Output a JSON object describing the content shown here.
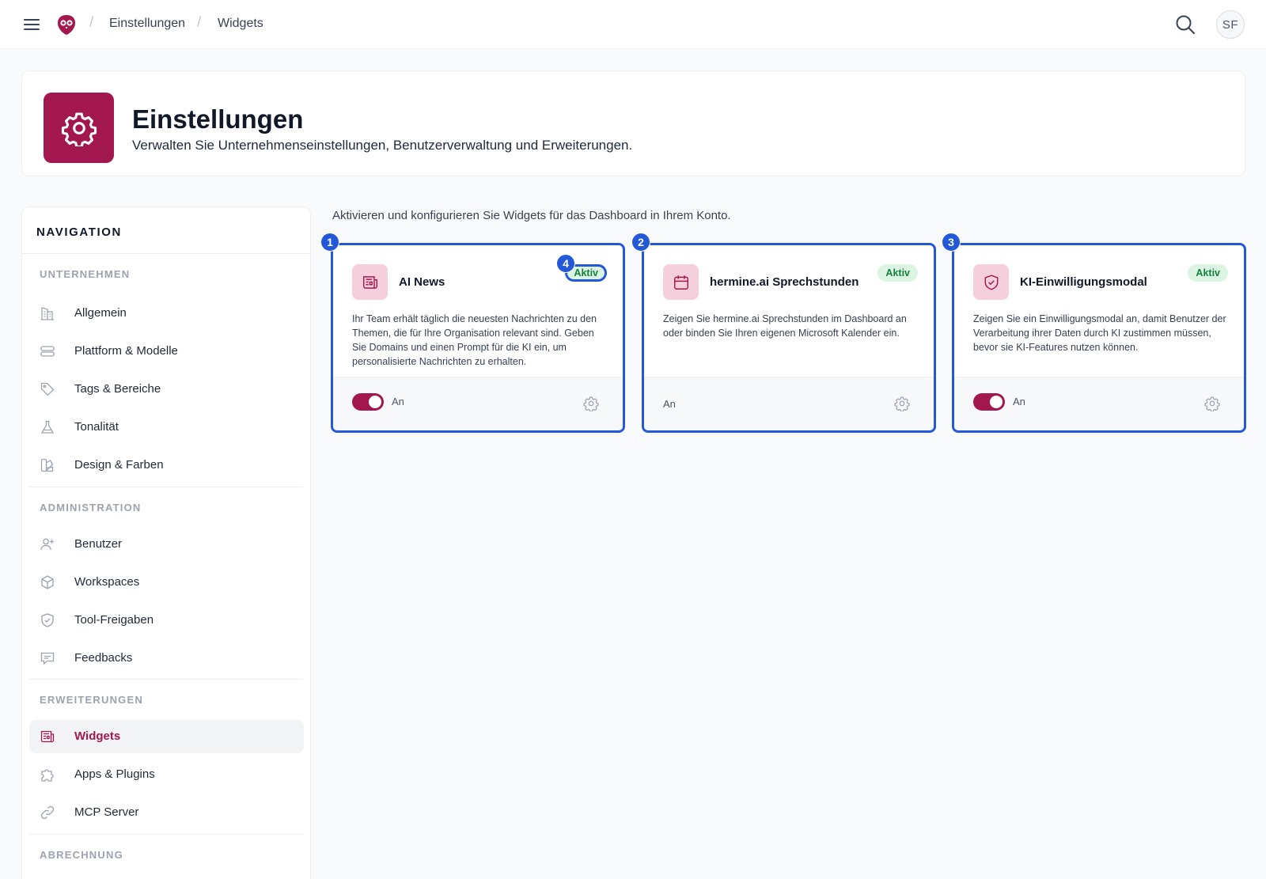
{
  "topbar": {
    "breadcrumbs": [
      "Einstellungen",
      "Widgets"
    ],
    "avatar_initials": "SF"
  },
  "header": {
    "title": "Einstellungen",
    "subtitle": "Verwalten Sie Unternehmenseinstellungen, Benutzerverwaltung und Erweiterungen."
  },
  "sidebar": {
    "title": "NAVIGATION",
    "sections": [
      {
        "label": "UNTERNEHMEN",
        "items": [
          {
            "label": "Allgemein",
            "icon": "building-icon"
          },
          {
            "label": "Plattform & Modelle",
            "icon": "server-icon"
          },
          {
            "label": "Tags & Bereiche",
            "icon": "tag-icon"
          },
          {
            "label": "Tonalität",
            "icon": "flask-icon"
          },
          {
            "label": "Design & Farben",
            "icon": "palette-icon"
          }
        ]
      },
      {
        "label": "ADMINISTRATION",
        "items": [
          {
            "label": "Benutzer",
            "icon": "user-plus-icon"
          },
          {
            "label": "Workspaces",
            "icon": "cube-icon"
          },
          {
            "label": "Tool-Freigaben",
            "icon": "shield-check-icon"
          },
          {
            "label": "Feedbacks",
            "icon": "chat-icon"
          }
        ]
      },
      {
        "label": "ERWEITERUNGEN",
        "items": [
          {
            "label": "Widgets",
            "icon": "newspaper-icon",
            "active": true
          },
          {
            "label": "Apps & Plugins",
            "icon": "puzzle-icon"
          },
          {
            "label": "MCP Server",
            "icon": "link-icon"
          }
        ]
      },
      {
        "label": "ABRECHNUNG",
        "items": []
      }
    ]
  },
  "main": {
    "intro": "Aktivieren und konfigurieren Sie Widgets für das Dashboard in Ihrem Konto.",
    "widgets": [
      {
        "marker": "1",
        "title": "AI News",
        "badge": "Aktiv",
        "badge_marker": "4",
        "description": "Ihr Team erhält täglich die neuesten Nachrichten zu den Themen, die für Ihre Organisation relevant sind. Geben Sie Domains und einen Prompt für die KI ein, um personalisierte Nachrichten zu erhalten.",
        "toggle_label": "An",
        "toggle_visible": true,
        "icon": "newspaper-icon"
      },
      {
        "marker": "2",
        "title": "hermine.ai Sprechstunden",
        "badge": "Aktiv",
        "description": "Zeigen Sie hermine.ai Sprechstunden im Dashboard an oder binden Sie Ihren eigenen Microsoft Kalender ein.",
        "toggle_label": "An",
        "toggle_visible": false,
        "icon": "calendar-icon"
      },
      {
        "marker": "3",
        "title": "KI-Einwilligungsmodal",
        "badge": "Aktiv",
        "description": "Zeigen Sie ein Einwilligungsmodal an, damit Benutzer der Verarbeitung ihrer Daten durch KI zustimmen müssen, bevor sie KI-Features nutzen können.",
        "toggle_label": "An",
        "toggle_visible": true,
        "icon": "shield-check-icon"
      }
    ]
  },
  "colors": {
    "brand": "#a3174f",
    "brand_light": "#f6cfdc",
    "highlight": "#2458d6",
    "badge_bg": "#dcf5e3",
    "badge_text": "#15803d"
  }
}
